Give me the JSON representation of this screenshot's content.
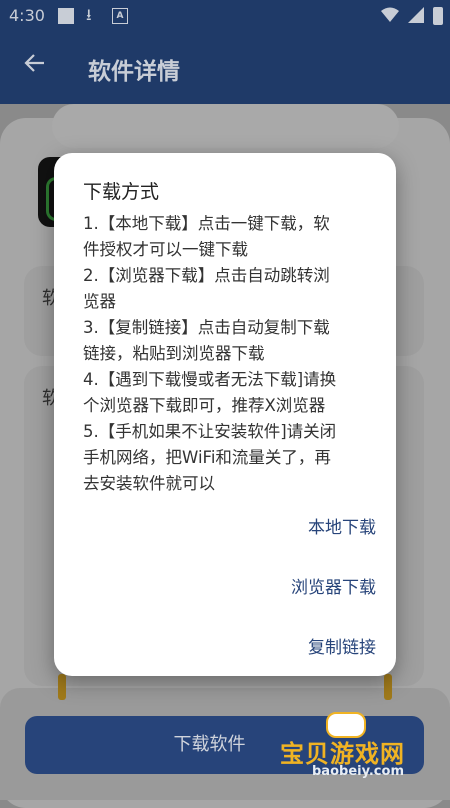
{
  "status_bar": {
    "time": "4:30",
    "icons": [
      "square-notification-icon",
      "download-icon",
      "a-box-icon",
      "wifi-icon",
      "signal-icon",
      "battery-icon"
    ]
  },
  "app_bar": {
    "back_icon": "arrow-left-icon",
    "title": "软件详情"
  },
  "background": {
    "card1_text": "软",
    "card2_text": "软",
    "download_button": "下载软件"
  },
  "dialog": {
    "title": "下载方式",
    "lines": [
      "1.【本地下载】点击一键下载，软",
      "件授权才可以一键下载",
      "2.【浏览器下载】点击自动跳转浏",
      "览器",
      "3.【复制链接】点击自动复制下载",
      "链接，粘贴到浏览器下载",
      "4.【遇到下载慢或者无法下载]请换",
      "个浏览器下载即可，推荐X浏览器",
      "5.【手机如果不让安装软件]请关闭",
      "手机网络，把WiFi和流量关了，再",
      "去安装软件就可以"
    ],
    "actions": {
      "local": "本地下载",
      "browser": "浏览器下载",
      "copy": "复制链接"
    }
  },
  "watermark": {
    "text": "宝贝游戏网",
    "url": "baobeiy.com"
  },
  "colors": {
    "primary": "#27447a",
    "dialog_bg": "#ffffff",
    "watermark_gold": "#f0b323"
  }
}
